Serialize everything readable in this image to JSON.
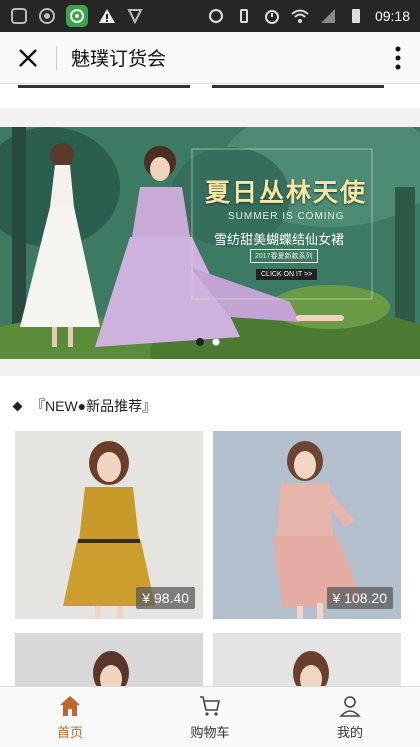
{
  "status_bar": {
    "time": "09:18"
  },
  "nav": {
    "title": "魅璞订货会"
  },
  "banner": {
    "headline": "夏日丛林天使",
    "subtitle": "SUMMER IS COMING",
    "tagline": "雪纺甜美蝴蝶结仙女裙",
    "small_text": "2017春夏新款系列",
    "button": "CLICK ON IT >>",
    "slides": 2,
    "active_slide": 1
  },
  "section": {
    "title": "『NEW●新品推荐』"
  },
  "products": [
    {
      "price": "¥ 98.40",
      "color": "#c89a2a"
    },
    {
      "price": "¥ 108.20",
      "color": "#e8b5ac"
    },
    {
      "price": "",
      "color": "#cfcfcf"
    },
    {
      "price": "",
      "color": "#e0e0e0"
    }
  ],
  "tabs": [
    {
      "label": "首页",
      "icon": "home-icon",
      "active": true
    },
    {
      "label": "购物车",
      "icon": "cart-icon",
      "active": false
    },
    {
      "label": "我的",
      "icon": "user-icon",
      "active": false
    }
  ],
  "colors": {
    "accent": "#c0652e",
    "status_bar": "#262626"
  }
}
